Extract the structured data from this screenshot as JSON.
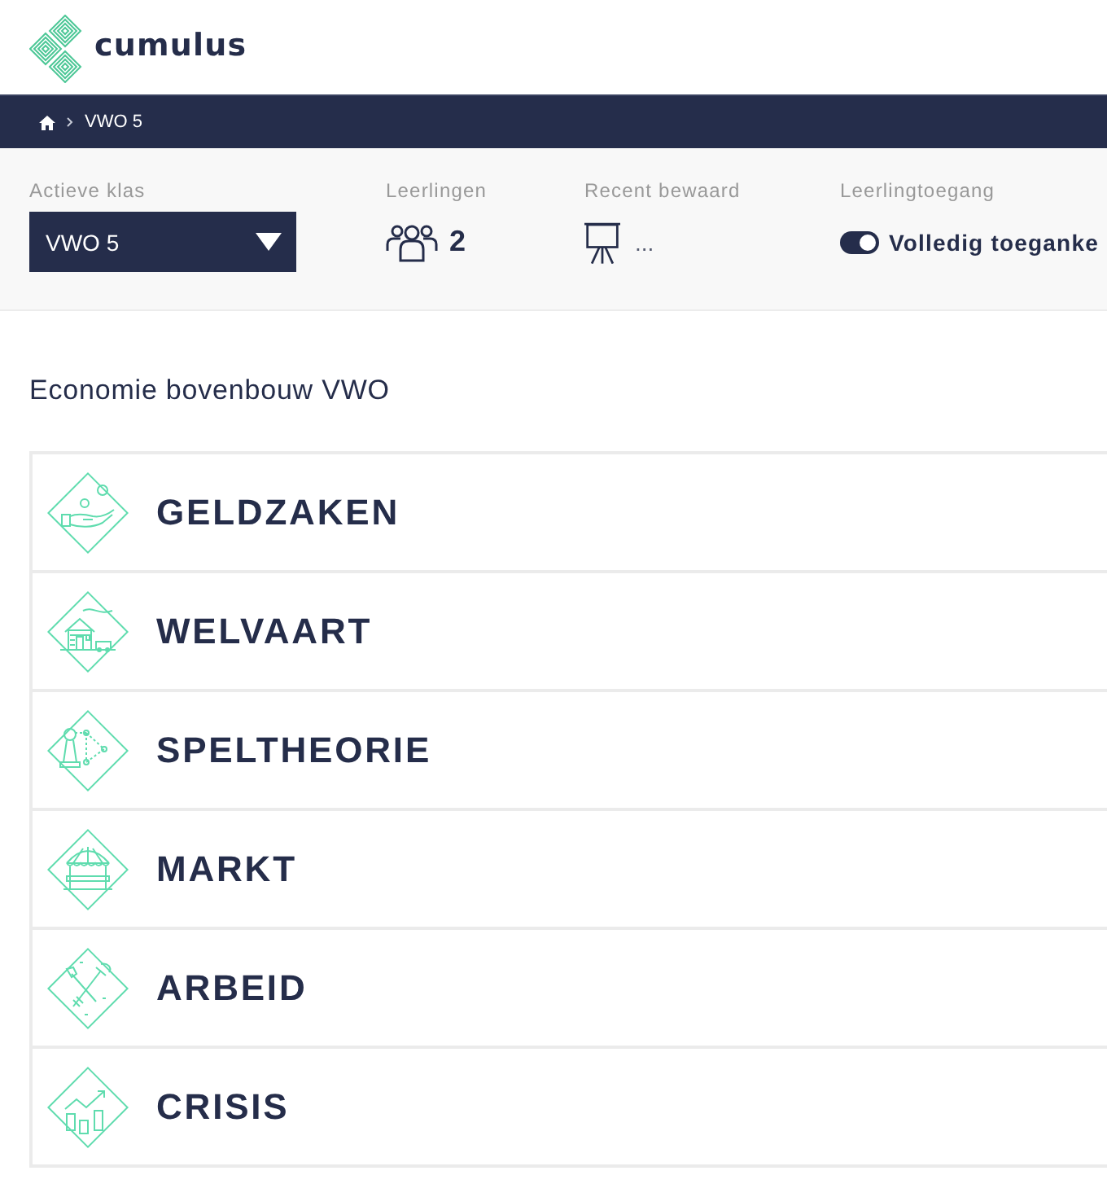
{
  "header": {
    "logo_text": "cumulus"
  },
  "breadcrumb": {
    "items": [
      "VWO 5"
    ]
  },
  "class_bar": {
    "active_class": {
      "label": "Actieve klas",
      "value": "VWO 5"
    },
    "students": {
      "label": "Leerlingen",
      "count": "2"
    },
    "recent_saved": {
      "label": "Recent bewaard",
      "value": "..."
    },
    "student_access": {
      "label": "Leerlingtoegang",
      "on": true,
      "value": "Volledig toeganke"
    }
  },
  "course": {
    "title": "Economie bovenbouw VWO",
    "chapters": [
      {
        "title": "GELDZAKEN"
      },
      {
        "title": "WELVAART"
      },
      {
        "title": "SPELTHEORIE"
      },
      {
        "title": "MARKT"
      },
      {
        "title": "ARBEID"
      },
      {
        "title": "CRISIS"
      }
    ]
  }
}
